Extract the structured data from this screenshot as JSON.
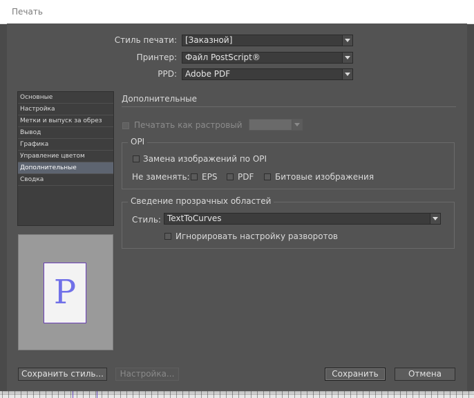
{
  "window": {
    "title": "Печать"
  },
  "top_fields": {
    "style": {
      "label": "Стиль печати:",
      "value": "[Заказной]"
    },
    "printer": {
      "label": "Принтер:",
      "value": "Файл PostScript®"
    },
    "ppd": {
      "label": "PPD:",
      "value": "Adobe PDF"
    }
  },
  "sidebar": {
    "items": [
      {
        "label": "Основные"
      },
      {
        "label": "Настройка"
      },
      {
        "label": "Метки и выпуск за обрез"
      },
      {
        "label": "Вывод"
      },
      {
        "label": "Графика"
      },
      {
        "label": "Управление цветом"
      },
      {
        "label": "Дополнительные"
      },
      {
        "label": "Сводка"
      }
    ],
    "selected_index": 6
  },
  "preview": {
    "letter": "P",
    "icon": "page-preview-icon"
  },
  "section": {
    "title": "Дополнительные",
    "raster": {
      "label": "Печатать как растровый",
      "checked": false,
      "enabled": false,
      "value": ""
    },
    "opi": {
      "title": "OPI",
      "replace_label": "Замена изображений по OPI",
      "do_not_replace_label": "Не заменять:",
      "eps": "EPS",
      "pdf": "PDF",
      "bitmap": "Битовые изображения"
    },
    "transparency": {
      "title": "Сведение прозрачных областей",
      "style_label": "Стиль:",
      "style_value": "TextToCurves",
      "ignore_label": "Игнорировать настройку разворотов"
    }
  },
  "buttons": {
    "save_style": "Сохранить стиль...",
    "setup": "Настройка...",
    "save": "Сохранить",
    "cancel": "Отмена"
  },
  "colors": {
    "panel": "#535353",
    "selection": "#5d6470",
    "preview_letter": "#7070e8",
    "page_border": "#6a3fb8"
  }
}
